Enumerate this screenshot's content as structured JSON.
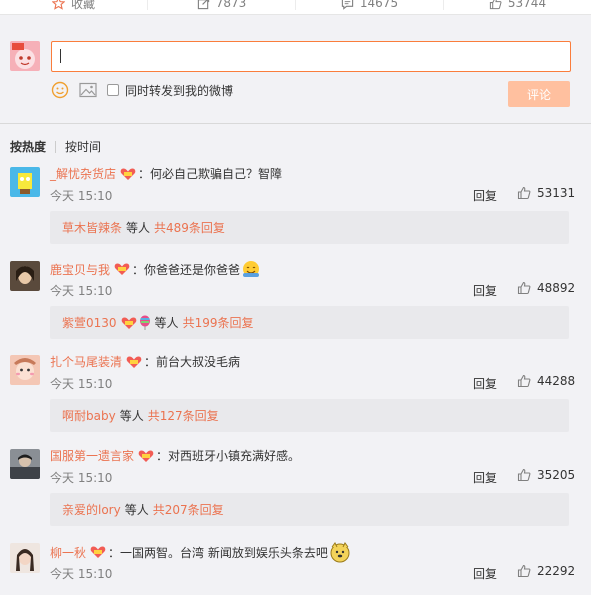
{
  "actions": [
    {
      "icon": "star-icon",
      "label": "收藏"
    },
    {
      "icon": "share-icon",
      "label": "7873"
    },
    {
      "icon": "comment-icon",
      "label": "14675"
    },
    {
      "icon": "like-icon",
      "label": "53744"
    }
  ],
  "composer": {
    "input_value": "",
    "repost_label": "同时转发到我的微博",
    "submit_label": "评论"
  },
  "sort": {
    "hot": "按热度",
    "time": "按时间"
  },
  "comments": [
    {
      "user": "_解忧杂货店",
      "text": "：何必自己欺骗自己？智障",
      "time": "今天 15:10",
      "reply": "回复",
      "likes": "53131",
      "sub_user": "草木皆辣条",
      "sub_mid": "等人",
      "sub_count": "共489条回复"
    },
    {
      "user": "鹿宝贝与我",
      "text": "：你爸爸还是你爸爸",
      "time": "今天 15:10",
      "reply": "回复",
      "likes": "48892",
      "sub_user": "紫萱0130",
      "sub_mid": "等人",
      "sub_count": "共199条回复"
    },
    {
      "user": "扎个马尾装清",
      "text": "：前台大叔没毛病",
      "time": "今天 15:10",
      "reply": "回复",
      "likes": "44288",
      "sub_user": "啊耐baby",
      "sub_mid": "等人",
      "sub_count": "共127条回复"
    },
    {
      "user": "国服第一遗言家",
      "text": "：对西班牙小镇充满好感。",
      "time": "今天 15:10",
      "reply": "回复",
      "likes": "35205",
      "sub_user": "亲爱的lory",
      "sub_mid": "等人",
      "sub_count": "共207条回复"
    },
    {
      "user": "柳一秋",
      "text": "：一国两智。台湾 新闻放到娱乐头条去吧",
      "time": "今天 15:10",
      "reply": "回复",
      "likes": "22292"
    }
  ],
  "colors": {
    "accent": "#eb7350",
    "input_border": "#fa7d3c",
    "submit_bg": "#ffc09f"
  }
}
